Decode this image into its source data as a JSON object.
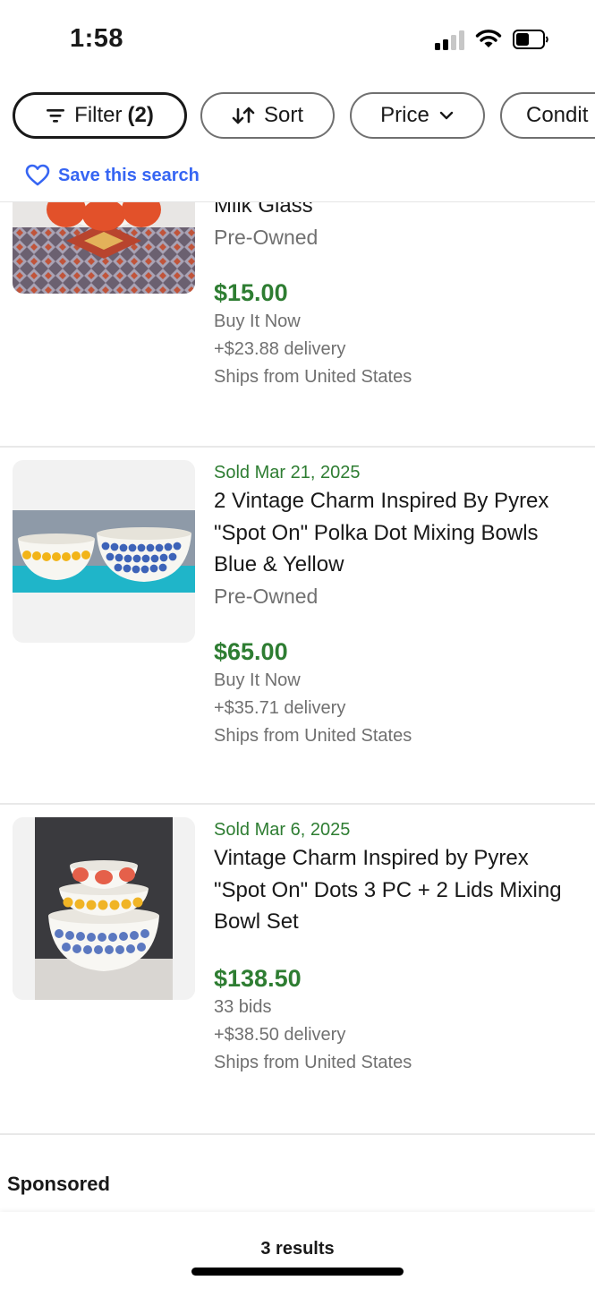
{
  "status_bar": {
    "time": "1:58"
  },
  "filters": {
    "filter_label": "Filter",
    "filter_count": "(2)",
    "sort_label": "Sort",
    "price_label": "Price",
    "condition_label": "Condit"
  },
  "save_search": {
    "label": "Save this search"
  },
  "listings": [
    {
      "title": "Milk Glass",
      "condition": "Pre-Owned",
      "price": "$15.00",
      "format": "Buy It Now",
      "delivery": "+$23.88 delivery",
      "ships": "Ships from United States"
    },
    {
      "sold": "Sold Mar 21, 2025",
      "title": "2 Vintage Charm Inspired By Pyrex \"Spot On\" Polka Dot Mixing Bowls Blue & Yellow",
      "condition": "Pre-Owned",
      "price": "$65.00",
      "format": "Buy It Now",
      "delivery": "+$35.71 delivery",
      "ships": "Ships from United States"
    },
    {
      "sold": "Sold Mar 6, 2025",
      "title": "Vintage Charm Inspired by Pyrex \"Spot On\" Dots 3 PC + 2 Lids Mixing Bowl Set",
      "price": "$138.50",
      "format": "33 bids",
      "delivery": "+$38.50 delivery",
      "ships": "Ships from United States"
    }
  ],
  "sponsored_label": "Sponsored",
  "results_label": "3 results",
  "colors": {
    "price_green": "#2e7d32",
    "link_blue": "#3665f3",
    "text_primary": "#191919",
    "text_secondary": "#707070"
  }
}
